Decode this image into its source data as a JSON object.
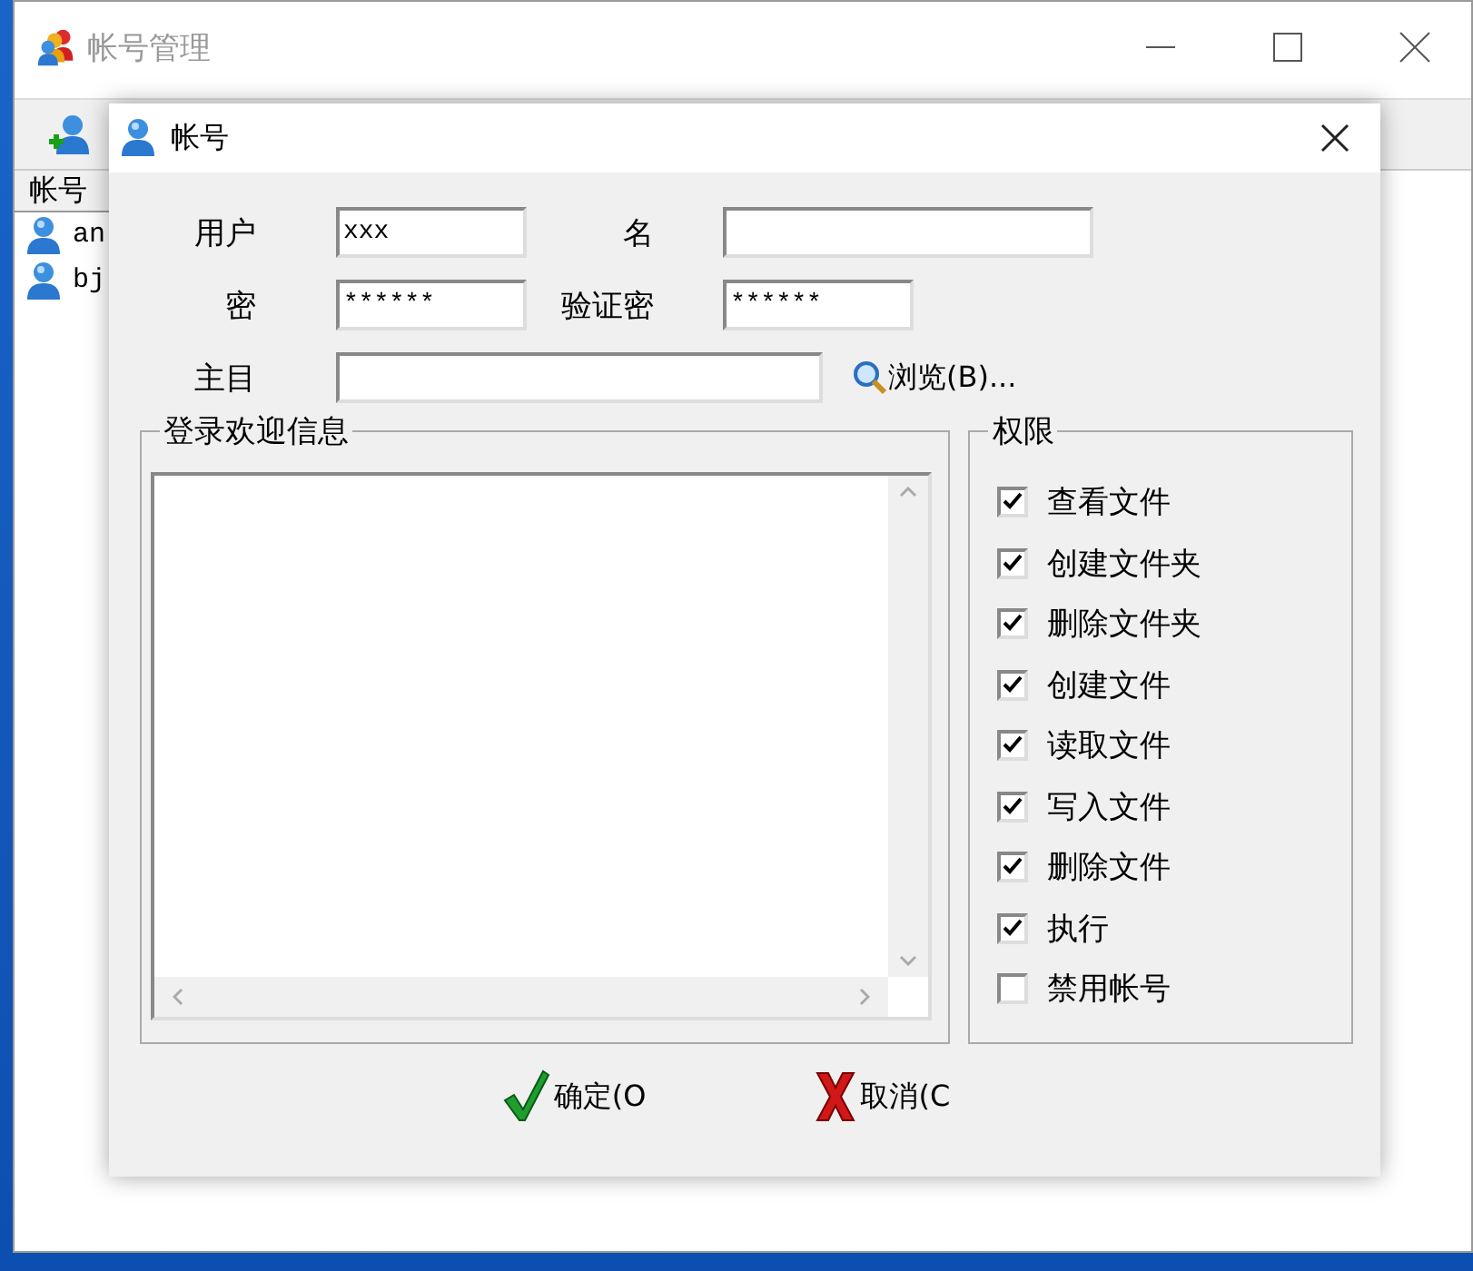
{
  "main_window": {
    "title": "帐号管理"
  },
  "account_list": {
    "column": "帐号",
    "items": [
      "an",
      "bj"
    ]
  },
  "dialog": {
    "title": "帐号",
    "fields": [
      {
        "label": "用户",
        "value": "xxx"
      },
      {
        "label": "名"
      },
      {
        "label": "密",
        "value": "******"
      },
      {
        "label": "验证密",
        "value": "******"
      },
      {
        "label": "主目"
      }
    ],
    "browse_button": "浏览(B)...",
    "welcome_group": {
      "title": "登录欢迎信息"
    },
    "permissions": {
      "title": "权限",
      "items": [
        {
          "label": "查看文件",
          "checked": true
        },
        {
          "label": "创建文件夹",
          "checked": true
        },
        {
          "label": "删除文件夹",
          "checked": true
        },
        {
          "label": "创建文件",
          "checked": true
        },
        {
          "label": "读取文件",
          "checked": true
        },
        {
          "label": "写入文件",
          "checked": true
        },
        {
          "label": "删除文件",
          "checked": true
        },
        {
          "label": "执行",
          "checked": true
        },
        {
          "label": "禁用帐号",
          "checked": false
        }
      ]
    },
    "buttons": [
      {
        "label": "确定(O",
        "kind": "ok"
      },
      {
        "label": "取消(C",
        "kind": "cancel"
      }
    ]
  }
}
